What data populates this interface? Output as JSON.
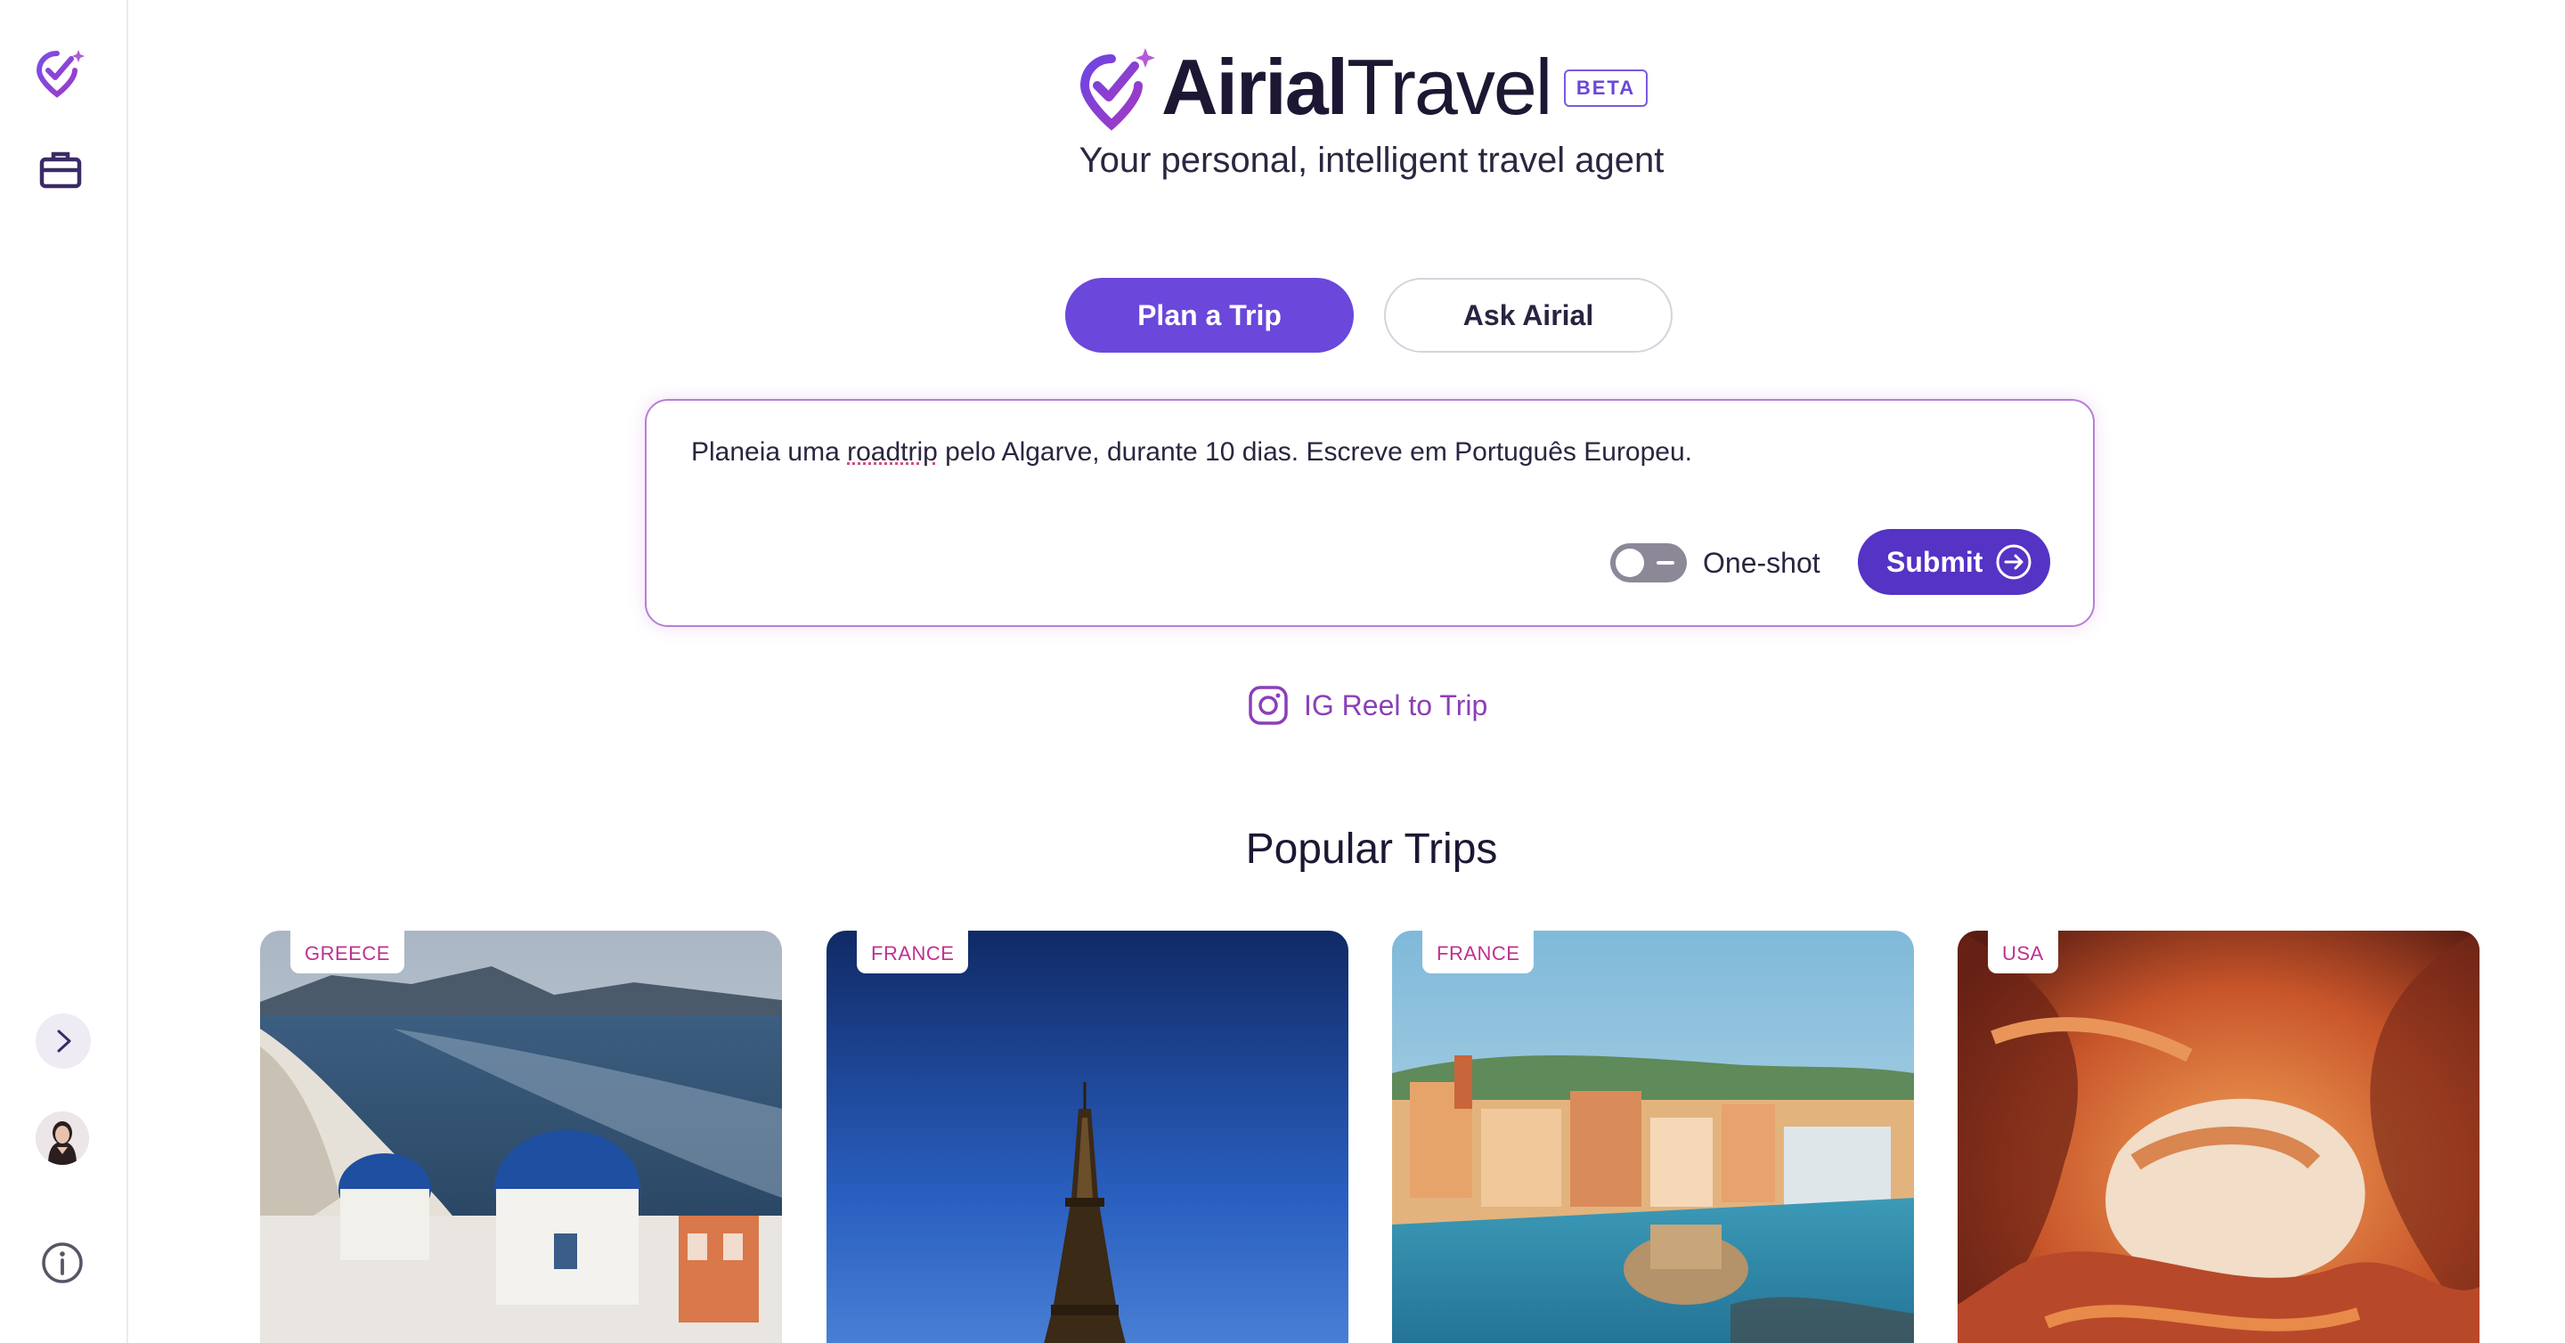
{
  "sidebar": {
    "icons": [
      "airial-logo-icon",
      "briefcase-icon",
      "chevron-right-icon",
      "user-avatar",
      "info-icon"
    ]
  },
  "brand": {
    "name_bold": "Airial",
    "name_light": "Travel",
    "beta": "BETA",
    "tagline": "Your personal, intelligent travel agent"
  },
  "modes": {
    "plan_label": "Plan a Trip",
    "ask_label": "Ask Airial",
    "active": "Plan a Trip"
  },
  "prompt": {
    "text_before": "Planeia uma ",
    "text_misspelled": "roadtrip",
    "text_after": " pelo Algarve, durante 10 dias. Escreve em Português Europeu.",
    "oneshot_label": "One-shot",
    "oneshot_enabled": false,
    "submit_label": "Submit"
  },
  "ig_link": {
    "label": "IG Reel to Trip"
  },
  "popular": {
    "title": "Popular Trips",
    "cards": [
      {
        "tag": "GREECE"
      },
      {
        "tag": "FRANCE"
      },
      {
        "tag": "FRANCE"
      },
      {
        "tag": "USA"
      }
    ]
  },
  "colors": {
    "primary": "#6b47dc",
    "submit": "#5533c4",
    "accent_pink": "#c0308f",
    "ig_purple": "#8b3fb8"
  }
}
